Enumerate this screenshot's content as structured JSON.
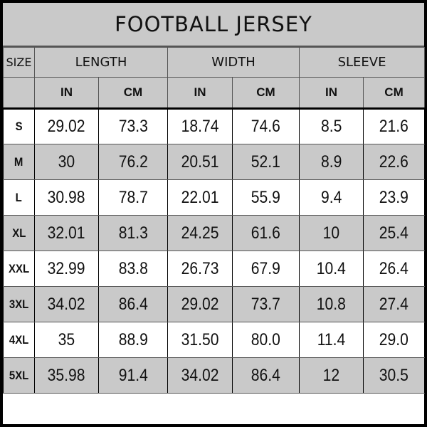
{
  "title": "FOOTBALL JERSEY",
  "headers": {
    "size": "SIZE",
    "groups": [
      "LENGTH",
      "WIDTH",
      "SLEEVE"
    ],
    "units": [
      "IN",
      "CM",
      "IN",
      "CM",
      "IN",
      "CM"
    ]
  },
  "rows": [
    {
      "size": "S",
      "values": [
        "29.02",
        "73.3",
        "18.74",
        "74.6",
        "8.5",
        "21.6"
      ]
    },
    {
      "size": "M",
      "values": [
        "30",
        "76.2",
        "20.51",
        "52.1",
        "8.9",
        "22.6"
      ]
    },
    {
      "size": "L",
      "values": [
        "30.98",
        "78.7",
        "22.01",
        "55.9",
        "9.4",
        "23.9"
      ]
    },
    {
      "size": "XL",
      "values": [
        "32.01",
        "81.3",
        "24.25",
        "61.6",
        "10",
        "25.4"
      ]
    },
    {
      "size": "XXL",
      "values": [
        "32.99",
        "83.8",
        "26.73",
        "67.9",
        "10.4",
        "26.4"
      ]
    },
    {
      "size": "3XL",
      "values": [
        "34.02",
        "86.4",
        "29.02",
        "73.7",
        "10.8",
        "27.4"
      ]
    },
    {
      "size": "4XL",
      "values": [
        "35",
        "88.9",
        "31.50",
        "80.0",
        "11.4",
        "29.0"
      ]
    },
    {
      "size": "5XL",
      "values": [
        "35.98",
        "91.4",
        "34.02",
        "86.4",
        "12",
        "30.5"
      ]
    }
  ]
}
